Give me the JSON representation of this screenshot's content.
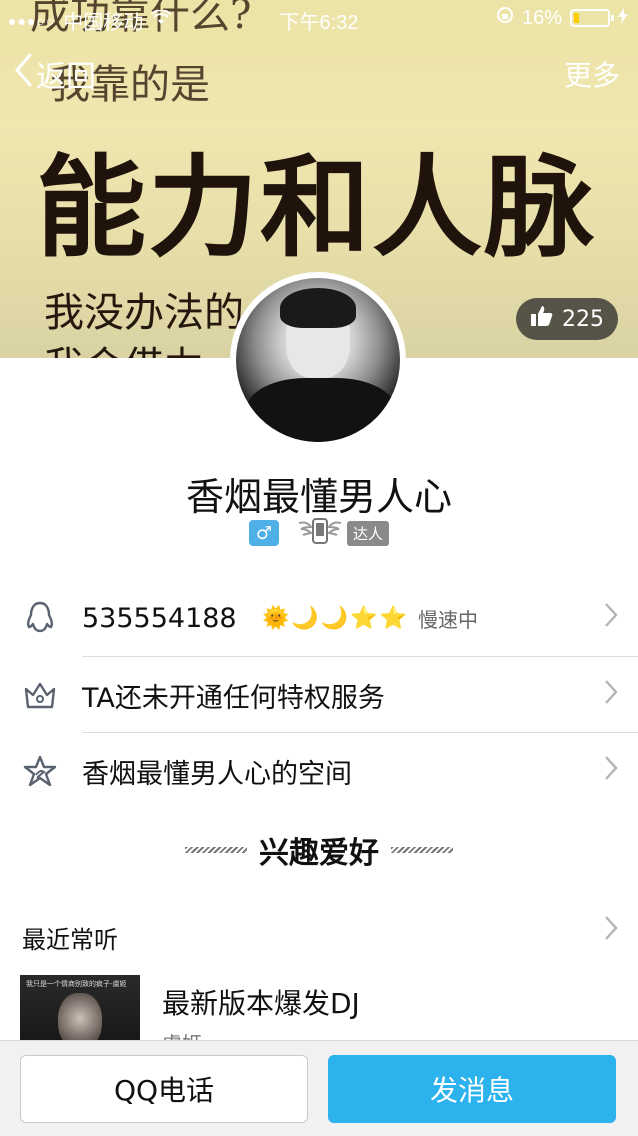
{
  "status_bar": {
    "signal": "●●●○○",
    "carrier": "中国移动",
    "time": "下午6:32",
    "battery_percent": "16%",
    "battery_level": 0.16
  },
  "banner": {
    "line1": "成功靠什么?",
    "line2": "我靠的是",
    "line3": "能力和人脉",
    "line4": "我没办法的",
    "line5": "我会借力"
  },
  "nav": {
    "back_label": "返回",
    "more_label": "更多"
  },
  "likes": {
    "count": "225"
  },
  "profile": {
    "name": "香烟最懂男人心",
    "gender_symbol": "♂",
    "daren_label": "达人"
  },
  "rows": {
    "qq": {
      "number": "535554188",
      "levels": "🌞🌙🌙⭐⭐",
      "speed_status": "慢速中"
    },
    "privilege": {
      "label": "TA还未开通任何特权服务"
    },
    "space": {
      "label": "香烟最懂男人心的空间"
    }
  },
  "hobbies": {
    "title": "兴趣爱好",
    "recent_title": "最近常听",
    "song": {
      "cover_caption": "我只是一个情商别致的疯子-虞姬",
      "title": "最新版本爆发DJ",
      "artist": "虞姬"
    }
  },
  "bottom": {
    "call_label": "QQ电话",
    "message_label": "发消息"
  },
  "colors": {
    "accent": "#2cb2ec",
    "gender_badge": "#4fb0e8",
    "battery": "#ffcc00"
  }
}
